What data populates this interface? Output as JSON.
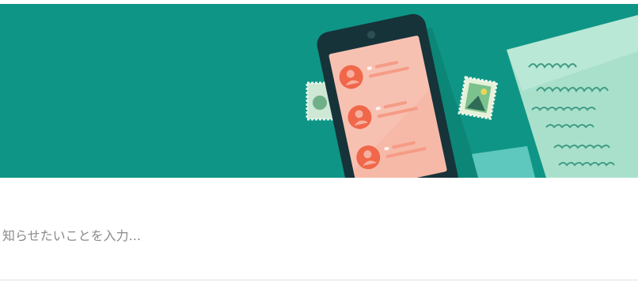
{
  "composer": {
    "placeholder": "知らせたいことを入力...",
    "value": ""
  },
  "banner": {
    "background_color": "#0f9585",
    "illustration": "phone-with-contacts-and-letter"
  },
  "icons": {
    "contact_1": "person-icon",
    "contact_2": "person-icon",
    "contact_3": "person-icon",
    "stamp_left": "stamp-icon",
    "stamp_right": "stamp-icon",
    "phone": "smartphone-icon",
    "letter": "letter-icon"
  }
}
